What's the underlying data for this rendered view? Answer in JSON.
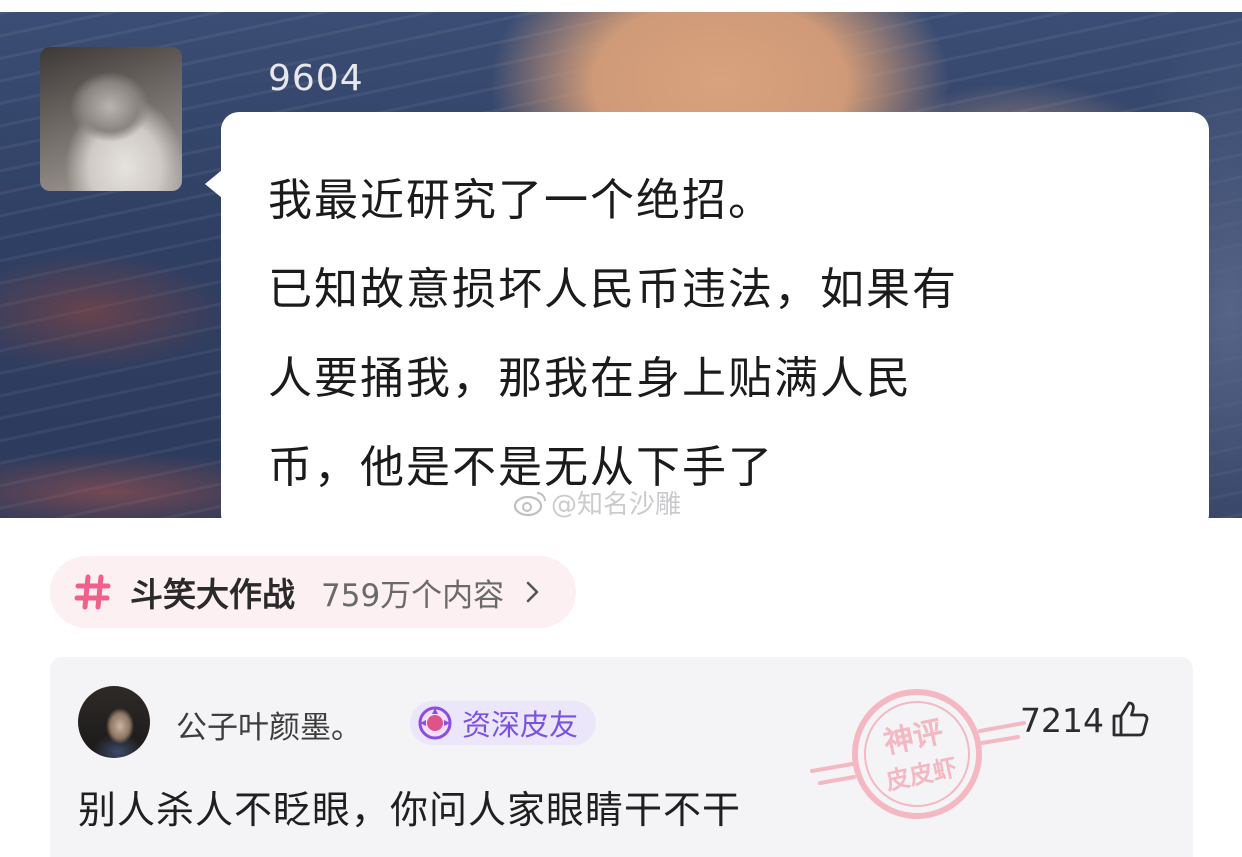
{
  "chat": {
    "sender_name": "9604",
    "message_lines": [
      "我最近研究了一个绝招。",
      "已知故意损坏人民币违法，如果有",
      "人要捅我，那我在身上贴满人民",
      "币，他是不是无从下手了"
    ],
    "watermark_text": "@知名沙雕",
    "watermark_icon": "weibo-icon"
  },
  "topic": {
    "icon": "hash-icon",
    "name": "斗笑大作战",
    "count": "759万个内容",
    "accent": "#f0608a"
  },
  "comment": {
    "username": "公子叶颜墨。",
    "badge": {
      "icon": "medal-icon",
      "text": "资深皮友",
      "color": "#7a52e0"
    },
    "stamp_lines": [
      "神评",
      "皮皮虾"
    ],
    "stamp_color": "#f4a5b3",
    "like_count": "7214",
    "like_icon": "thumbs-up-icon",
    "text": "别人杀人不眨眼，你问人家眼睛干不干"
  }
}
